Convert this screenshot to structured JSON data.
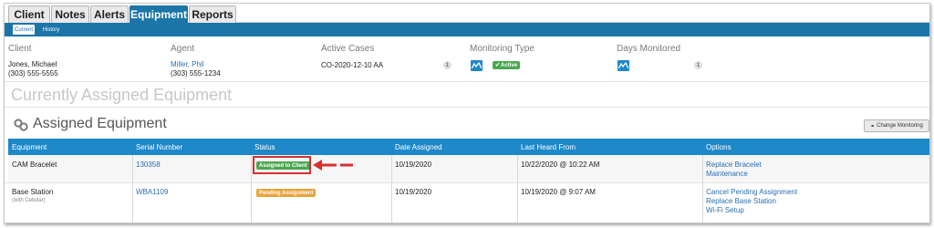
{
  "tabs": [
    {
      "label": "Client"
    },
    {
      "label": "Notes"
    },
    {
      "label": "Alerts"
    },
    {
      "label": "Equipment",
      "active": true
    },
    {
      "label": "Reports"
    }
  ],
  "subtabs": [
    {
      "label": "Current",
      "active": true
    },
    {
      "label": "History"
    }
  ],
  "summary": {
    "client": {
      "label": "Client",
      "name": "Jones, Michael",
      "phone": "(303) 555-5555"
    },
    "agent": {
      "label": "Agent",
      "name": "Miller, Phil",
      "phone": "(303) 555-1234"
    },
    "active_cases": {
      "label": "Active Cases",
      "value": "CO-2020-12-10 AA",
      "count": "1"
    },
    "monitoring_type": {
      "label": "Monitoring Type",
      "icon": "monitoring-icon",
      "badge": "Active"
    },
    "days_monitored": {
      "label": "Days Monitored",
      "icon": "monitoring-icon",
      "count": "1"
    }
  },
  "headings": {
    "currently_assigned": "Currently Assigned Equipment",
    "assigned": "Assigned Equipment",
    "change_button": "Change Monitoring"
  },
  "table": {
    "headers": [
      "Equipment",
      "Serial Number",
      "Status",
      "Date Assigned",
      "Last Heard From",
      "Options"
    ],
    "rows": [
      {
        "equipment": "CAM Bracelet",
        "sub": "",
        "serial": "130358",
        "status": "Assigned to Client",
        "status_color": "#4da64f",
        "date_assigned": "10/19/2020",
        "last_heard": "10/22/2020 @ 10:22 AM",
        "options": [
          "Replace Bracelet",
          "Maintenance"
        ]
      },
      {
        "equipment": "Base Station",
        "sub": "(with Cellular)",
        "serial": "WBA1109",
        "status": "Pending Assignment",
        "status_color": "#e8a33a",
        "date_assigned": "10/19/2020",
        "last_heard": "10/19/2020 @ 9:07 AM",
        "options": [
          "Cancel Pending Assignment",
          "Replace Base Station",
          "Wi-Fi Setup"
        ]
      }
    ]
  },
  "colors": {
    "brand": "#1b75a8",
    "table_header": "#1e88c9",
    "link": "#2a6fb0",
    "highlight": "#d73030"
  }
}
